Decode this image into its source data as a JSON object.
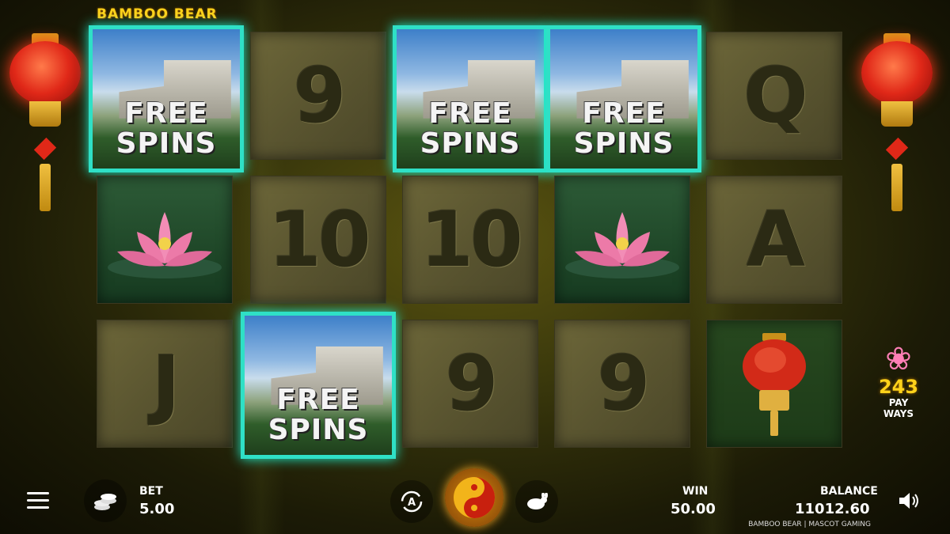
{
  "game": {
    "title": "BAMBOO BEAR",
    "footer": "BAMBOO BEAR | MASCOT GAMING"
  },
  "colors": {
    "highlight": "#2fe0c6",
    "title": "#ffd21a"
  },
  "reels": {
    "row1": [
      "FREE SPINS",
      "9",
      "FREE SPINS",
      "FREE SPINS",
      "Q"
    ],
    "row2": [
      "lotus",
      "10",
      "10",
      "lotus",
      "A"
    ],
    "row3": [
      "J",
      "FREE SPINS",
      "9",
      "9",
      "lantern"
    ],
    "free_spins_line1": "FREE",
    "free_spins_line2": "SPINS",
    "sym_9": "9",
    "sym_q": "Q",
    "sym_10": "10",
    "sym_a": "A",
    "sym_j": "J"
  },
  "payways": {
    "number": "243",
    "label1": "PAY",
    "label2": "WAYS"
  },
  "controls": {
    "bet_label": "BET",
    "bet_value": "5.00",
    "win_label": "WIN",
    "win_value": "50.00",
    "balance_label": "BALANCE",
    "balance_value": "11012.60",
    "autoplay_icon": "A"
  }
}
